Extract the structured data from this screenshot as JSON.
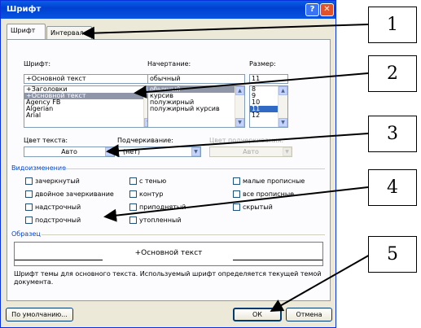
{
  "window": {
    "title": "Шрифт",
    "help_glyph": "?",
    "close_glyph": "✕"
  },
  "tabs": [
    {
      "label": "Шрифт",
      "active": true
    },
    {
      "label": "Интервал",
      "active": false
    }
  ],
  "font": {
    "label": "Шрифт:",
    "value": "+Основной текст",
    "items": [
      "+Заголовки",
      "+Основной текст",
      "Agency FB",
      "Algerian",
      "Arial"
    ],
    "selected_index": 1
  },
  "style": {
    "label": "Начертание:",
    "value": "обычный",
    "items": [
      "обычный",
      "курсив",
      "полужирный",
      "полужирный курсив"
    ],
    "selected_index": 0
  },
  "size": {
    "label": "Размер:",
    "value": "11",
    "items": [
      "8",
      "9",
      "10",
      "11",
      "12"
    ],
    "selected_index": 3
  },
  "text_color": {
    "label": "Цвет текста:",
    "value": "Авто"
  },
  "underline": {
    "label": "Подчеркивание:",
    "value": "(нет)"
  },
  "underline_color": {
    "label": "Цвет подчеркивания:",
    "value": "Авто"
  },
  "effects": {
    "label": "Видоизменение",
    "items": [
      "зачеркнутый",
      "двойное зачеркивание",
      "надстрочный",
      "подстрочный",
      "с тенью",
      "контур",
      "приподнятый",
      "утопленный",
      "малые прописные",
      "все прописные",
      "скрытый"
    ]
  },
  "preview": {
    "label": "Образец",
    "text": "+Основной текст"
  },
  "description": "Шрифт темы для основного текста. Используемый шрифт определяется текущей темой документа.",
  "buttons": {
    "default": "По умолчанию...",
    "ok": "ОК",
    "cancel": "Отмена"
  },
  "callouts": [
    "1",
    "2",
    "3",
    "4",
    "5"
  ]
}
